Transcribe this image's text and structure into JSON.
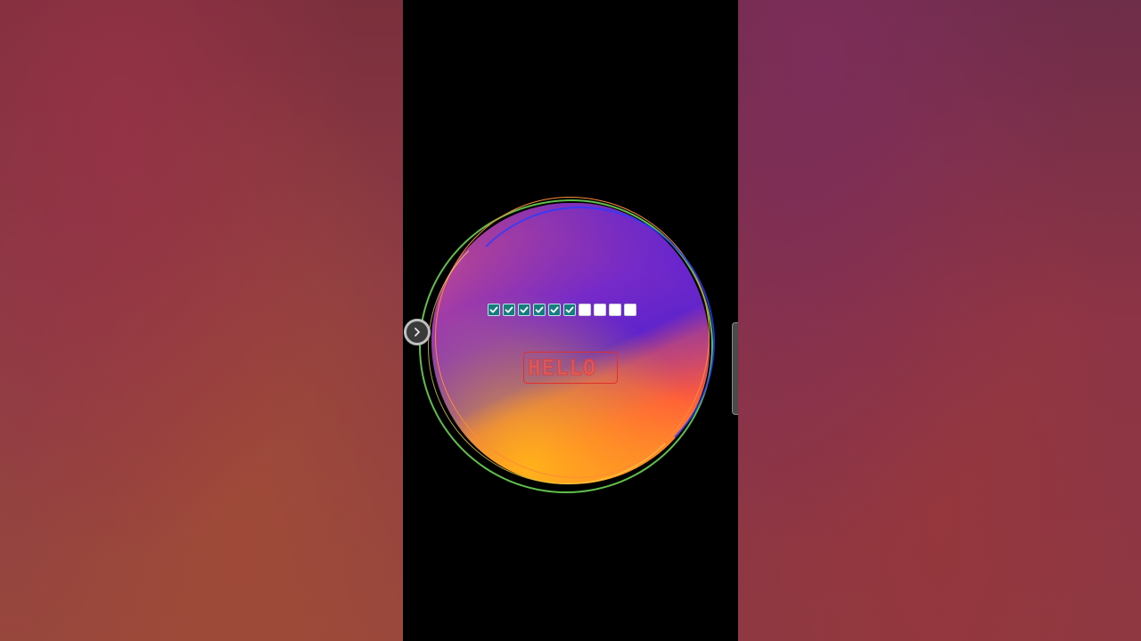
{
  "video": {
    "background_left_color": "#8e3b45",
    "background_right_color": "#7d2f4a",
    "phone_screen_color": "#000000"
  },
  "blob": {
    "gradient_colors": [
      "#5a22cc",
      "#c44a8a",
      "#ff5a3a",
      "#ffa21e"
    ],
    "ring_colors": [
      "#5fbf4a",
      "#ff8a3a",
      "#2838ff",
      "#ffe650"
    ]
  },
  "progress": {
    "total": 10,
    "checked": 6,
    "checked_color": "#167c80",
    "unchecked_color": "#ffffff"
  },
  "text_field": {
    "value": "HELLO",
    "border_color": "#e0302a"
  },
  "controls": {
    "nav_handle_icon": "chevron-right-icon",
    "edge_handle_icon": "side-panel-handle"
  }
}
